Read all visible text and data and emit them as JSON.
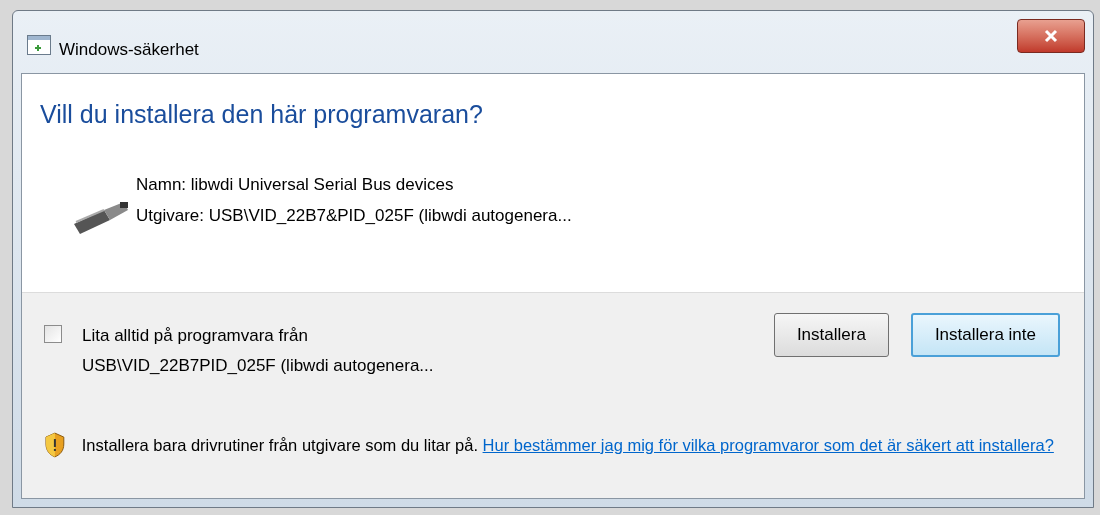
{
  "window": {
    "title": "Windows-säkerhet"
  },
  "heading": "Vill du installera den här programvaran?",
  "details": [
    "Namn: libwdi Universal Serial Bus devices",
    "Utgivare: USB\\VID_22B7&PID_025F (libwdi autogenera..."
  ],
  "trust": {
    "label": "Lita alltid på programvara från",
    "source": "USB\\VID_22B7PID_025F (libwdi autogenera...",
    "checked": false
  },
  "buttons": [
    {
      "label": "Installera",
      "default": false
    },
    {
      "label": "Installera inte",
      "default": true
    }
  ],
  "footer": {
    "text": "Installera bara drivrutiner från utgivare som du litar på.",
    "link": "Hur bestämmer jag mig för vilka programvaror som det är säkert att installera?"
  }
}
